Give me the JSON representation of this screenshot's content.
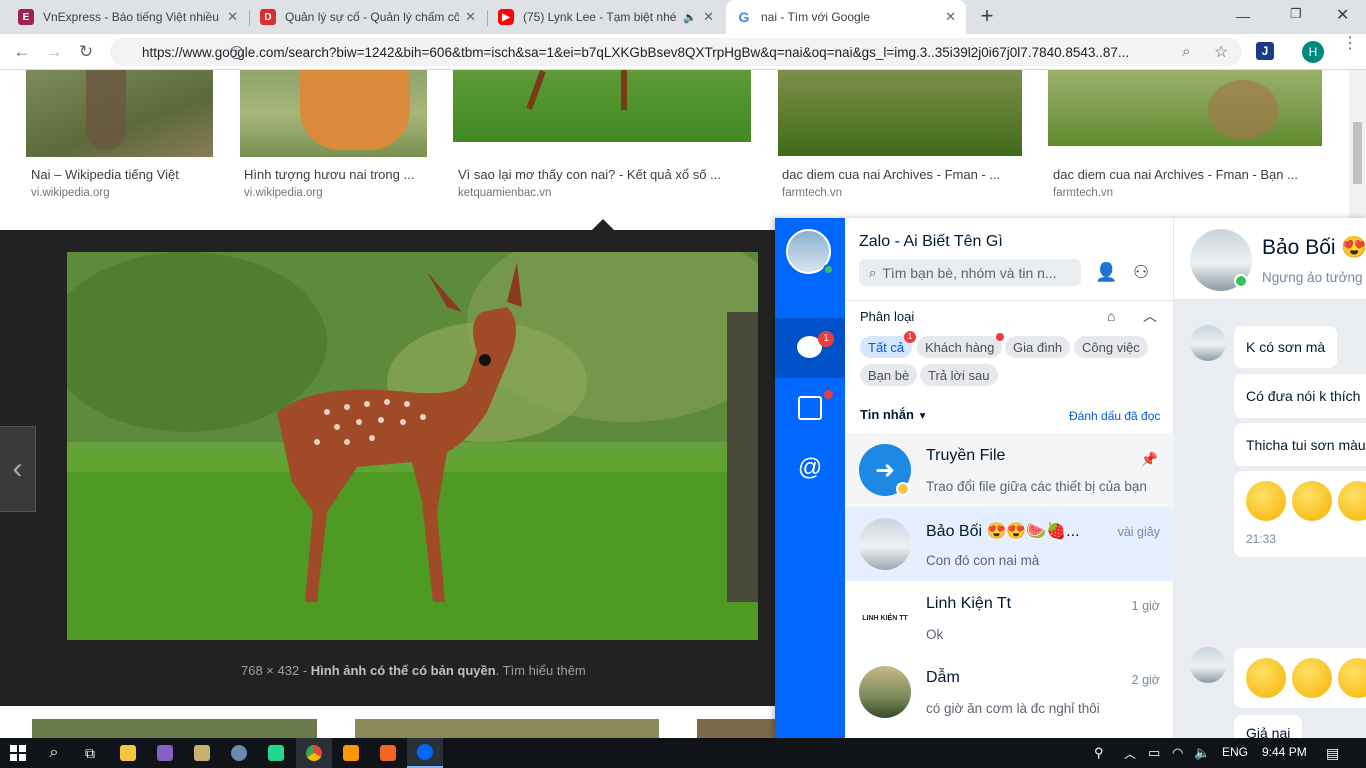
{
  "browser": {
    "tabs": [
      {
        "title": "VnExpress - Báo tiếng Việt nhiều",
        "favicon": "vnexpress-icon",
        "color": "#9f224e"
      },
      {
        "title": "Quản lý sự cố - Quản lý chấm cô",
        "favicon": "app-icon",
        "color": "#d9302c"
      },
      {
        "title": "(75) Lynk Lee - Tạm biệt nhé",
        "favicon": "youtube-icon",
        "color": "#ff0000"
      },
      {
        "title": "nai - Tìm với Google",
        "favicon": "google-icon",
        "color": "#4285f4"
      }
    ],
    "new_tab": "+",
    "url": "https://www.google.com/search?biw=1242&bih=606&tbm=isch&sa=1&ei=b7qLXKGbBsev8QXTrpHgBw&q=nai&oq=nai&gs_l=img.3..35i39l2j0i67j0l7.7840.8543..87...",
    "profile_initial": "H"
  },
  "results_row": [
    {
      "caption": "Nai – Wikipedia tiếng Việt",
      "source": "vi.wikipedia.org"
    },
    {
      "caption": "Hình tượng hươu nai trong ...",
      "source": "vi.wikipedia.org"
    },
    {
      "caption": "Vì sao lại mơ thấy con nai? - Kết quả xổ số ...",
      "source": "ketquamienbac.vn"
    },
    {
      "caption": "dac diem cua nai Archives - Fman - ...",
      "source": "farmtech.vn"
    },
    {
      "caption": "dac diem cua nai Archives - Fman - Bạn ...",
      "source": "farmtech.vn"
    }
  ],
  "preview": {
    "dimensions": "768 × 432",
    "copyright": "Hình ảnh có thể có bản quyền",
    "learn_more": "Tìm hiểu thêm"
  },
  "zalo": {
    "title": "Zalo - Ai Biết Tên Gì",
    "search_placeholder": "Tìm bạn bè, nhóm và tin n...",
    "rail_badge": "1",
    "filter_label": "Phân loại",
    "chips": [
      "Tất cả",
      "Khách hàng",
      "Gia đình",
      "Công việc",
      "Bạn bè",
      "Trả lời sau"
    ],
    "chip_badge": "1",
    "messages_label": "Tin nhắn",
    "mark_read": "Đánh dấu đã đọc",
    "conversations": [
      {
        "name": "Truyền File",
        "preview": "Trao đổi file giữa các thiết bị của bạn",
        "time": ""
      },
      {
        "name": "Bảo Bối 😍😍🍉🍓...",
        "preview": "Con đó con nai mà",
        "time": "vài giây"
      },
      {
        "name": "Linh Kiện Tt",
        "preview": "Ok",
        "time": "1 giờ"
      },
      {
        "name": "Dẫm",
        "preview": "có giờ ăn cơm là đc nghỉ thôi",
        "time": "2 giờ"
      }
    ],
    "linh_kien_logo": "LINH KIỆN TT",
    "chat": {
      "name": "Bảo Bối 😍",
      "status": "Ngưng ảo tưởng",
      "bubbles": [
        "K có sơn mà",
        "Có đưa nói k thích",
        "Thicha tui sơn màu",
        "Giả nai"
      ],
      "timestamp": "21:33"
    }
  },
  "taskbar": {
    "language": "ENG",
    "time": "9:44 PM"
  }
}
